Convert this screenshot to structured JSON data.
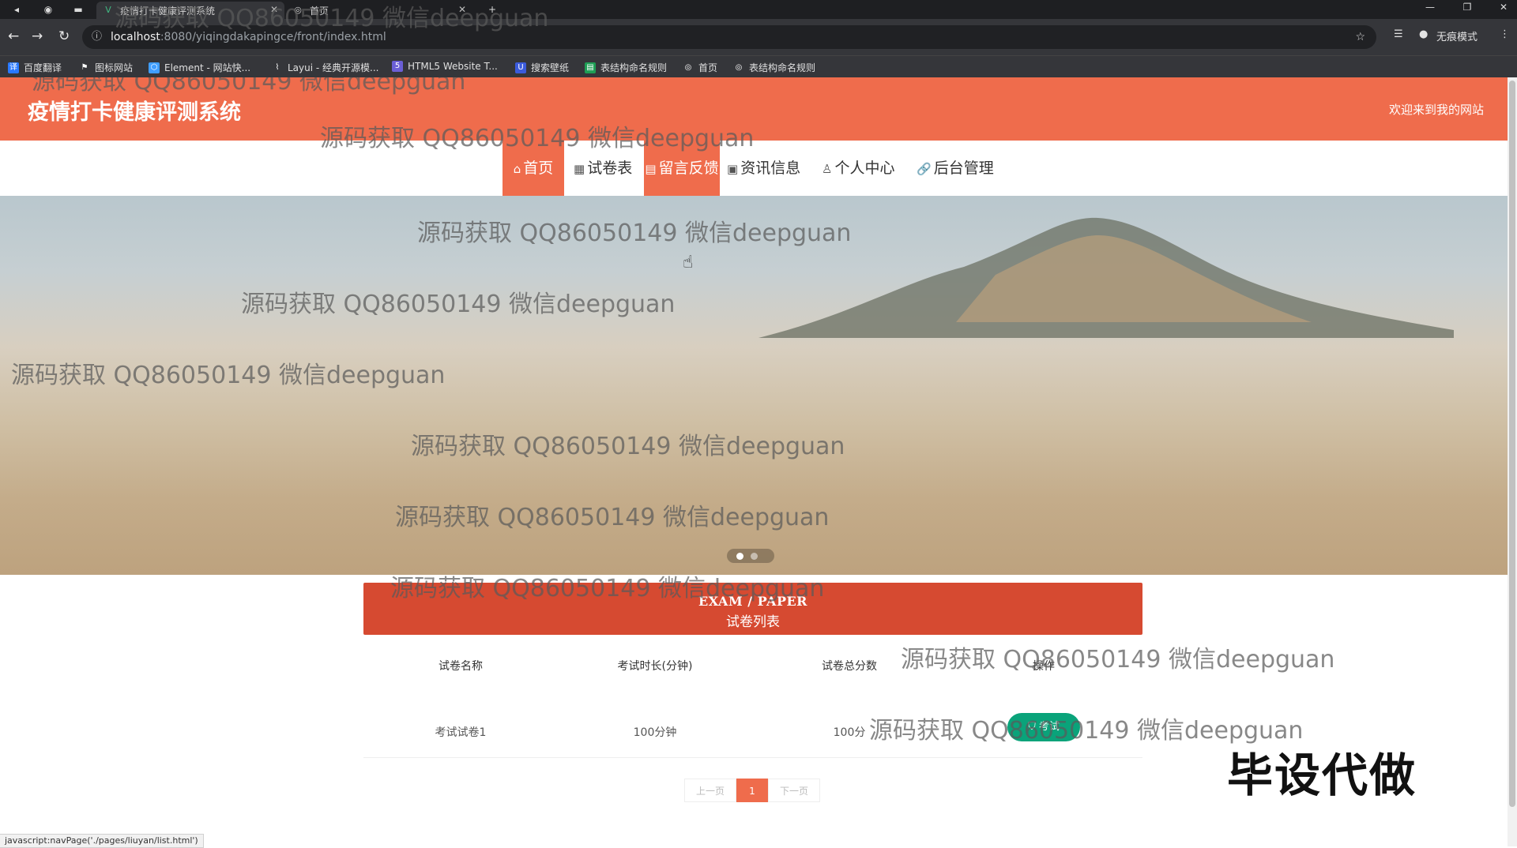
{
  "browser": {
    "tabs": [
      {
        "title": "疫情打卡健康评测系统",
        "icon": "vue-icon",
        "active": true
      },
      {
        "title": "首页",
        "icon": "globe-icon",
        "active": false
      }
    ],
    "url_host": "localhost",
    "url_path": ":8080/yiqingdakapingce/front/index.html",
    "profile_label": "无痕模式",
    "bookmarks": [
      "百度翻译",
      "图标网站",
      "Element - 网站快...",
      "Layui - 经典开源模...",
      "HTML5 Website T...",
      "搜索壁纸",
      "表结构命名规则",
      "首页",
      "表结构命名规则"
    ]
  },
  "header": {
    "title": "疫情打卡健康评测系统",
    "welcome": "欢迎来到我的网站"
  },
  "menu": [
    {
      "label": "首页",
      "icon": "home-icon",
      "state": "active"
    },
    {
      "label": "试卷表",
      "icon": "grid-icon",
      "state": ""
    },
    {
      "label": "留言反馈",
      "icon": "message-icon",
      "state": "hover"
    },
    {
      "label": "资讯信息",
      "icon": "news-icon",
      "state": ""
    },
    {
      "label": "个人中心",
      "icon": "user-icon",
      "state": ""
    },
    {
      "label": "后台管理",
      "icon": "link-icon",
      "state": ""
    }
  ],
  "section": {
    "title_en": "EXAM / PAPER",
    "title_cn": "试卷列表"
  },
  "table": {
    "columns": [
      "试卷名称",
      "考试时长(分钟)",
      "试卷总分数",
      "操作"
    ],
    "rows": [
      {
        "name": "考试试卷1",
        "duration": "100分钟",
        "score": "100分",
        "action": "考试"
      }
    ]
  },
  "pagination": {
    "prev": "上一页",
    "current": "1",
    "next": "下一页"
  },
  "status_url": "javascript:navPage('./pages/liuyan/list.html')",
  "watermark": "源码获取 QQ86050149 微信deepguan",
  "stamp": "毕设代做",
  "colors": {
    "header_bg": "#ef6c4c",
    "list_head_bg": "#d64a31",
    "exam_button": "#0aa37a"
  }
}
